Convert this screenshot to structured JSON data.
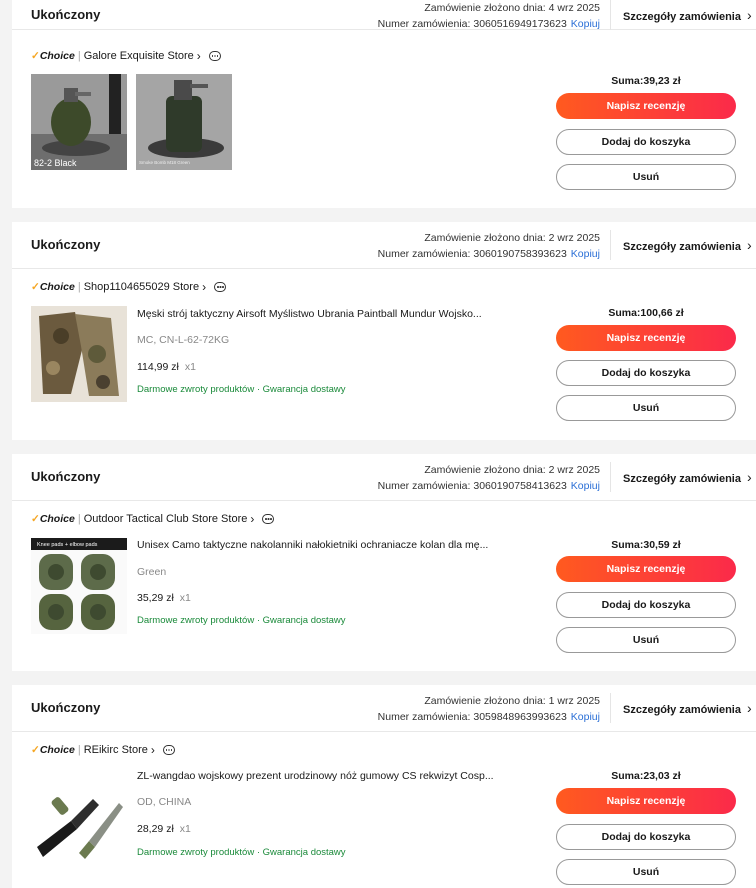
{
  "orders": [
    {
      "status": "Ukończony",
      "date": "Zamówienie złożono dnia: 4 wrz 2025",
      "number": "Numer zamówienia: 3060516949173623",
      "copy": "Kopiuj",
      "details": "Szczegóły zamówienia",
      "store": "Galore Exquisite Store",
      "item": null,
      "thumbs": [
        {
          "caption": "82-2 Black"
        },
        {
          "caption": "Smoke Bomb M18 Green"
        }
      ],
      "sum": "Suma:39,23 zł",
      "actions": {
        "review": "Napisz recenzję",
        "cart": "Dodaj do koszyka",
        "remove": "Usuń"
      }
    },
    {
      "status": "Ukończony",
      "date": "Zamówienie złożono dnia: 2 wrz 2025",
      "number": "Numer zamówienia: 3060190758393623",
      "copy": "Kopiuj",
      "details": "Szczegóły zamówienia",
      "store": "Shop1104655029 Store",
      "item": {
        "title": "Męski strój taktyczny Airsoft Myślistwo Ubrania Paintball Mundur Wojsko...",
        "variant": "MC, CN-L-62-72KG",
        "price": "114,99 zł",
        "qty": "x1",
        "benefits": "Darmowe zwroty produktów · Gwarancja dostawy"
      },
      "sum": "Suma:100,66 zł",
      "actions": {
        "review": "Napisz recenzję",
        "cart": "Dodaj do koszyka",
        "remove": "Usuń"
      }
    },
    {
      "status": "Ukończony",
      "date": "Zamówienie złożono dnia: 2 wrz 2025",
      "number": "Numer zamówienia: 3060190758413623",
      "copy": "Kopiuj",
      "details": "Szczegóły zamówienia",
      "store": "Outdoor Tactical Club Store Store",
      "item": {
        "title": "Unisex Camo taktyczne nakolanniki nałokietniki ochraniacze kolan dla mę...",
        "variant": "Green",
        "price": "35,29 zł",
        "qty": "x1",
        "benefits": "Darmowe zwroty produktów · Gwarancja dostawy",
        "thumb_caption": "Knee pads + elbow pads"
      },
      "sum": "Suma:30,59 zł",
      "actions": {
        "review": "Napisz recenzję",
        "cart": "Dodaj do koszyka",
        "remove": "Usuń"
      }
    },
    {
      "status": "Ukończony",
      "date": "Zamówienie złożono dnia: 1 wrz 2025",
      "number": "Numer zamówienia: 3059848963993623",
      "copy": "Kopiuj",
      "details": "Szczegóły zamówienia",
      "store": "REikirc Store",
      "item": {
        "title": "ZL-wangdao wojskowy prezent urodzinowy nóż gumowy CS rekwizyt Cosp...",
        "variant": "OD, CHINA",
        "price": "28,29 zł",
        "qty": "x1",
        "benefits": "Darmowe zwroty produktów · Gwarancja dostawy"
      },
      "sum": "Suma:23,03 zł",
      "actions": {
        "review": "Napisz recenzję",
        "cart": "Dodaj do koszyka",
        "remove": "Usuń"
      }
    }
  ],
  "choice_label": "Choice",
  "colors": {
    "accent": "#fb3a2e",
    "link": "#2b6fd6",
    "benefit": "#1a8a3a",
    "page_bg": "#f3f3f3"
  },
  "icons": {
    "chevron": "chevron-right-icon",
    "message": "message-icon",
    "choice": "choice-check-icon"
  }
}
